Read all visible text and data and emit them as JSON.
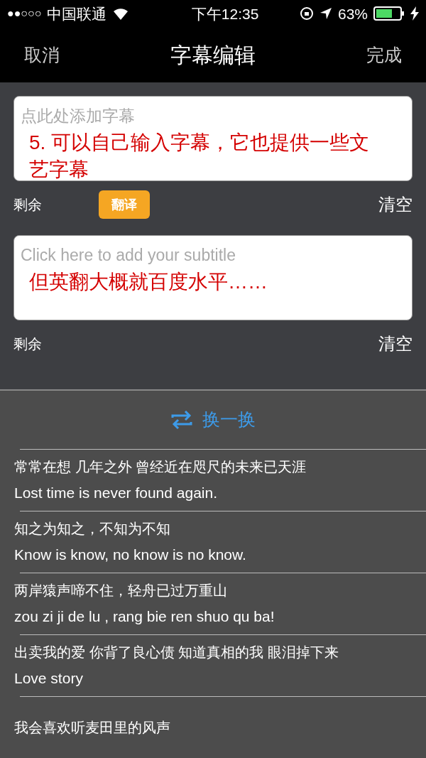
{
  "status_bar": {
    "signal": "●●○○○",
    "carrier": "中国联通",
    "time": "下午12:35",
    "battery": "63%"
  },
  "nav": {
    "cancel": "取消",
    "title": "字幕编辑",
    "done": "完成"
  },
  "editors": [
    {
      "placeholder": "点此处添加字幕",
      "annotation": "5.  可以自己输入字幕，它也提供一些文艺字幕",
      "remaining": "剩余",
      "translate": "翻译",
      "clear": "清空"
    },
    {
      "placeholder": "Click here to add your subtitle",
      "annotation": "但英翻大概就百度水平……",
      "remaining": "剩余",
      "clear": "清空"
    }
  ],
  "shuffle": "换一换",
  "suggestions": [
    {
      "zh": "常常在想 几年之外 曾经近在咫尺的未来已天涯",
      "en": "Lost time is never found again."
    },
    {
      "zh": "知之为知之，不知为不知",
      "en": "Know is know, no know is no know."
    },
    {
      "zh": "两岸猿声啼不住，轻舟已过万重山",
      "en": "zou zi ji de lu , rang bie ren shuo qu ba!"
    },
    {
      "zh": "出卖我的爱 你背了良心债 知道真相的我 眼泪掉下来",
      "en": "Love story"
    },
    {
      "zh": "我会喜欢听麦田里的风声"
    }
  ]
}
